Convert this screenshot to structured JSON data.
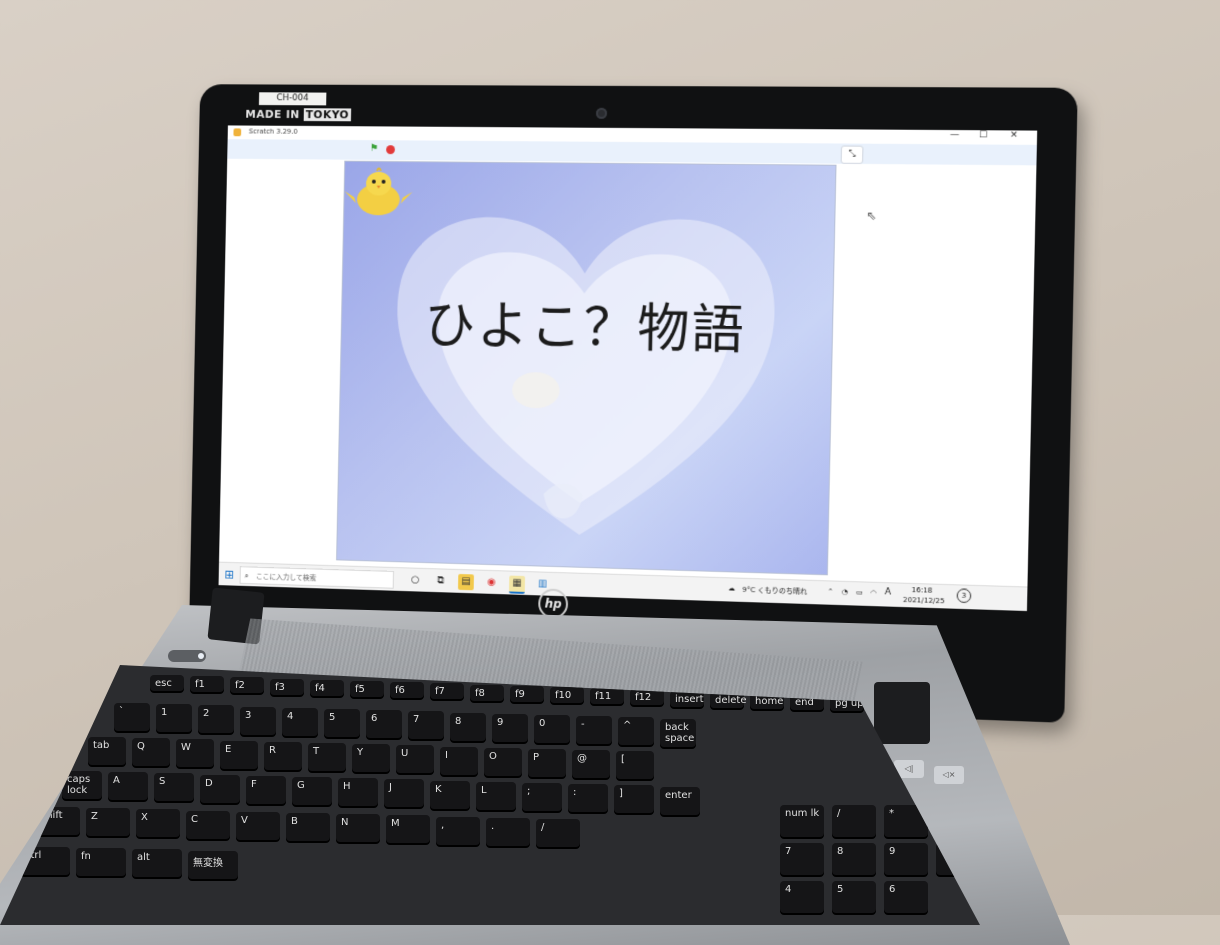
{
  "device": {
    "asset_tag": "CH-004",
    "sticker_prefix": "MADE IN ",
    "sticker_box": "TOKYO",
    "brand_logo": "hp"
  },
  "window": {
    "title": "Scratch 3.29.0",
    "controls": [
      "—",
      "☐",
      "✕"
    ]
  },
  "toolbar": {
    "green_flag": "green-flag-icon",
    "stop": "stop-icon",
    "fullscreen_icon": "⤡"
  },
  "stage": {
    "title": "ひよこ？物語",
    "colors": {
      "bg_start": "#9aa6e8",
      "bg_end": "#c9d4f6",
      "heart": "#e9edfb",
      "chick": "#f3cf43"
    }
  },
  "taskbar": {
    "search_placeholder": "ここに入力して検索",
    "weather": "9°C くもりのち晴れ",
    "ime": "A",
    "time": "16:18",
    "date": "2021/12/25",
    "notifications": "3"
  },
  "keyboard": {
    "rows": [
      [
        "esc",
        "f1",
        "f2",
        "f3",
        "f4",
        "f5",
        "f6",
        "f7",
        "f8",
        "f9",
        "f10",
        "f11",
        "f12",
        "insert",
        "delete",
        "home",
        "end",
        "pg up",
        "pg dn"
      ],
      [
        "`",
        "1",
        "2",
        "3",
        "4",
        "5",
        "6",
        "7",
        "8",
        "9",
        "0",
        "-",
        "^",
        "back space"
      ],
      [
        "tab",
        "Q",
        "W",
        "E",
        "R",
        "T",
        "Y",
        "U",
        "I",
        "O",
        "P",
        "@",
        "["
      ],
      [
        "caps lock",
        "A",
        "S",
        "D",
        "F",
        "G",
        "H",
        "J",
        "K",
        "L",
        ";",
        ":",
        "]",
        "enter"
      ],
      [
        "shift",
        "Z",
        "X",
        "C",
        "V",
        "B",
        "N",
        "M",
        ",",
        ".",
        "/"
      ],
      [
        "ctrl",
        "fn",
        "alt",
        "無変換"
      ]
    ],
    "numpad": [
      "num lk",
      "/",
      "*",
      "-",
      "7",
      "8",
      "9",
      "+",
      "4",
      "5",
      "6"
    ]
  }
}
